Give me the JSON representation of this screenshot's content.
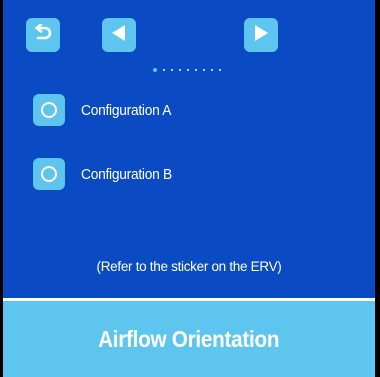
{
  "nav": {
    "back_icon": "undo-arrow-icon",
    "prev_icon": "left-triangle-icon",
    "next_icon": "right-triangle-icon"
  },
  "pager": {
    "total_pages": 9,
    "current_page": 1
  },
  "options": [
    {
      "label": "Configuration A",
      "selected": false
    },
    {
      "label": "Configuration B",
      "selected": false
    }
  ],
  "note": "(Refer to the sticker on the ERV)",
  "footer": {
    "title": "Airflow Orientation"
  },
  "colors": {
    "background": "#0a4bc4",
    "accent": "#5ec6ee",
    "text": "#ffffff"
  }
}
